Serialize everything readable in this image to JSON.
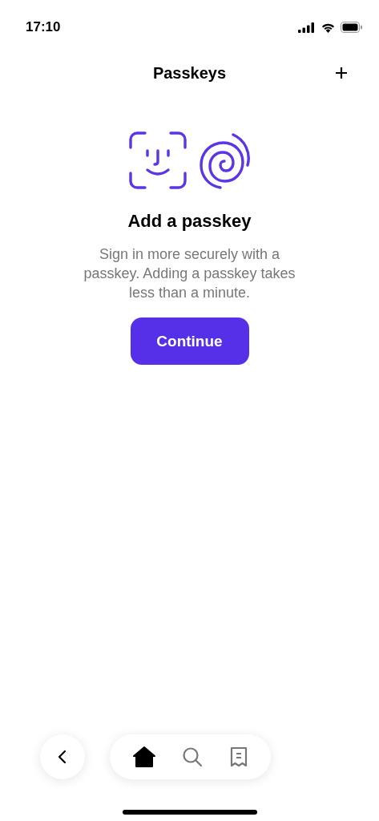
{
  "status_bar": {
    "time": "17:10"
  },
  "header": {
    "title": "Passkeys"
  },
  "empty_state": {
    "heading": "Add a passkey",
    "description": "Sign in more securely with a passkey. Adding a passkey takes less than a minute.",
    "button": "Continue"
  },
  "tab_bar": {
    "items": [
      {
        "kind": "home",
        "selected": true
      },
      {
        "kind": "search",
        "selected": false
      },
      {
        "kind": "receipt",
        "selected": false
      }
    ]
  }
}
